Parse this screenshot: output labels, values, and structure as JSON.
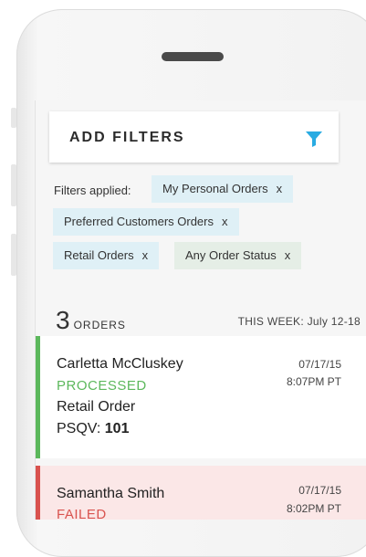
{
  "header": {
    "title": "ADD FILTERS",
    "filter_icon": "funnel-icon"
  },
  "filters": {
    "label": "Filters applied:",
    "close_glyph": "x",
    "chips": [
      {
        "label": "My Personal Orders"
      },
      {
        "label": "Preferred Customers Orders"
      },
      {
        "label": "Retail Orders"
      },
      {
        "label": "Any Order Status"
      }
    ]
  },
  "summary": {
    "count": "3",
    "count_label": "ORDERS",
    "week": "THIS WEEK: July 12-18"
  },
  "orders": [
    {
      "name": "Carletta McCluskey",
      "status": "PROCESSED",
      "status_color": "#5cb85c",
      "type": "Retail Order",
      "psqv_label": "PSQV:",
      "psqv_value": "101",
      "date": "07/17/15",
      "time": "8:07PM PT"
    },
    {
      "name": "Samantha Smith",
      "status": "FAILED",
      "status_color": "#d9534f",
      "date": "07/17/15",
      "time": "8:02PM PT"
    }
  ],
  "colors": {
    "accent": "#29abe2",
    "processed": "#5cb85c",
    "failed": "#d9534f"
  }
}
